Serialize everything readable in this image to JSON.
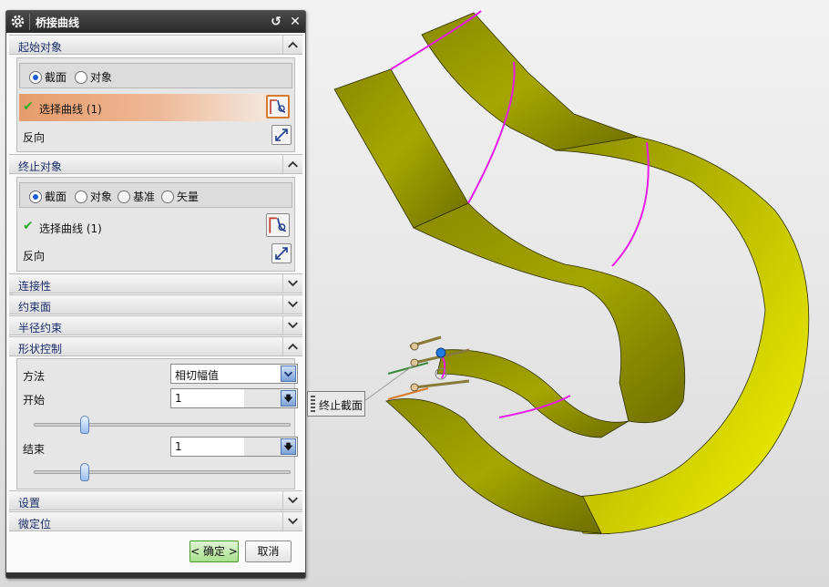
{
  "dialog": {
    "title": "桥接曲线",
    "reset_glyph": "↺",
    "close_glyph": "✕"
  },
  "start_object": {
    "header": "起始对象",
    "options": [
      "截面",
      "对象"
    ],
    "selected_option": "截面",
    "select_curve_label": "选择曲线 (1)",
    "reverse_label": "反向"
  },
  "end_object": {
    "header": "终止对象",
    "options": [
      "截面",
      "对象",
      "基准",
      "矢量"
    ],
    "selected_option": "截面",
    "select_curve_label": "选择曲线 (1)",
    "reverse_label": "反向"
  },
  "collapsed_sections": [
    "连接性",
    "约束面",
    "半径约束"
  ],
  "shape_control": {
    "header": "形状控制",
    "method_label": "方法",
    "method_value": "相切幅值",
    "start_label": "开始",
    "start_value": "1",
    "start_slider_fraction": 0.2,
    "end_label": "结束",
    "end_value": "1",
    "end_slider_fraction": 0.2
  },
  "bottom_sections": [
    "设置",
    "微定位"
  ],
  "buttons": {
    "ok": "< 确定 >",
    "cancel": "取消"
  },
  "viewport": {
    "tooltip": "终止截面",
    "surface_color": "#a3a300",
    "curve_color": "#e81ce8"
  },
  "icons": [
    "gear-icon",
    "reset-icon",
    "close-icon",
    "chevron-up-icon",
    "chevron-down-icon",
    "check-icon",
    "select-curve-icon",
    "reverse-icon",
    "dropdown-arrow-icon"
  ]
}
